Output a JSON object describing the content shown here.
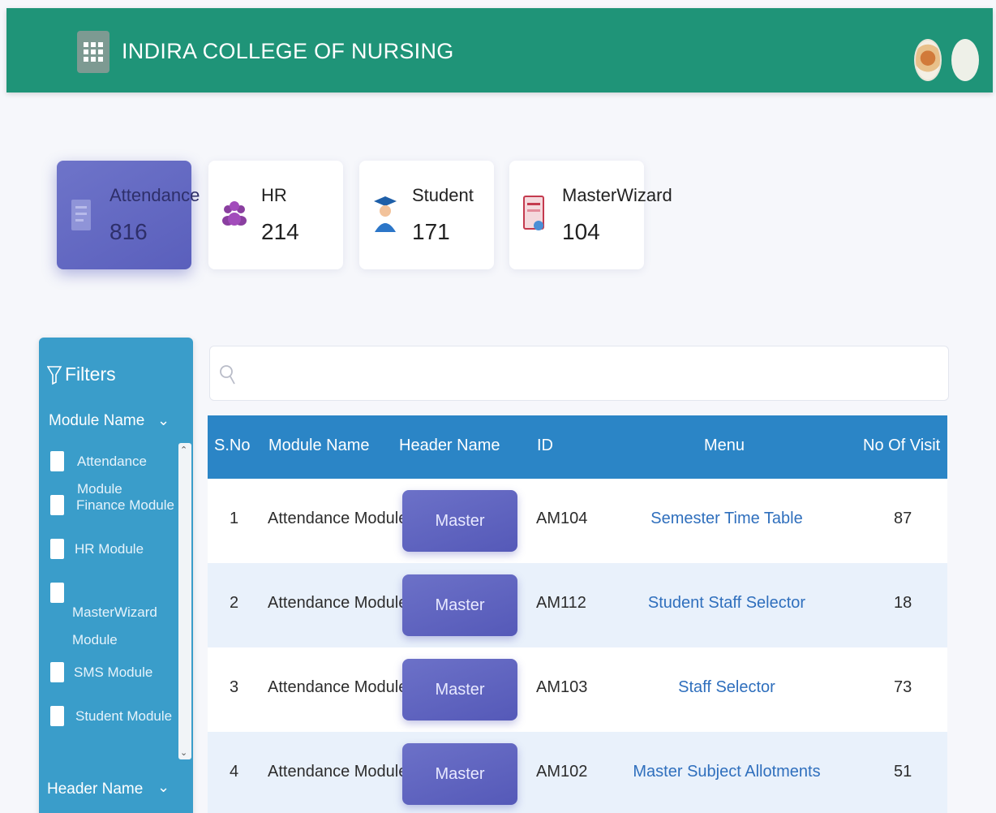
{
  "header": {
    "title": "INDIRA COLLEGE OF NURSING"
  },
  "cards": [
    {
      "label": "Attendance",
      "value": "816",
      "icon": "document-icon"
    },
    {
      "label": "HR",
      "value": "214",
      "icon": "group-icon"
    },
    {
      "label": "Student",
      "value": "171",
      "icon": "graduate-icon"
    },
    {
      "label": "MasterWizard",
      "value": "104",
      "icon": "certificate-icon"
    }
  ],
  "filters": {
    "title": "Filters",
    "module_section": "Module Name",
    "modules": [
      "Attendance Module",
      "Finance Module",
      "HR Module",
      "MasterWizard Module",
      "SMS Module",
      "Student Module"
    ],
    "header_section": "Header Name"
  },
  "search": {
    "placeholder": "",
    "value": ""
  },
  "table": {
    "columns": [
      "S.No",
      "Module Name",
      "Header Name",
      "ID",
      "Menu",
      "No Of Visit"
    ],
    "rows": [
      {
        "sno": "1",
        "module": "Attendance Module",
        "header": "Master",
        "id": "AM104",
        "menu": "Semester Time Table",
        "visits": "87"
      },
      {
        "sno": "2",
        "module": "Attendance Module",
        "header": "Master",
        "id": "AM112",
        "menu": "Student Staff Selector",
        "visits": "18"
      },
      {
        "sno": "3",
        "module": "Attendance Module",
        "header": "Master",
        "id": "AM103",
        "menu": "Staff Selector",
        "visits": "73"
      },
      {
        "sno": "4",
        "module": "Attendance Module",
        "header": "Master",
        "id": "AM102",
        "menu": "Master Subject Allotments",
        "visits": "51"
      }
    ]
  },
  "colors": {
    "topbar": "#1f9478",
    "active_card": "#5a5fbc",
    "filters_panel": "#3a9dca",
    "table_header": "#2b85c6",
    "link": "#2f6fbd"
  }
}
